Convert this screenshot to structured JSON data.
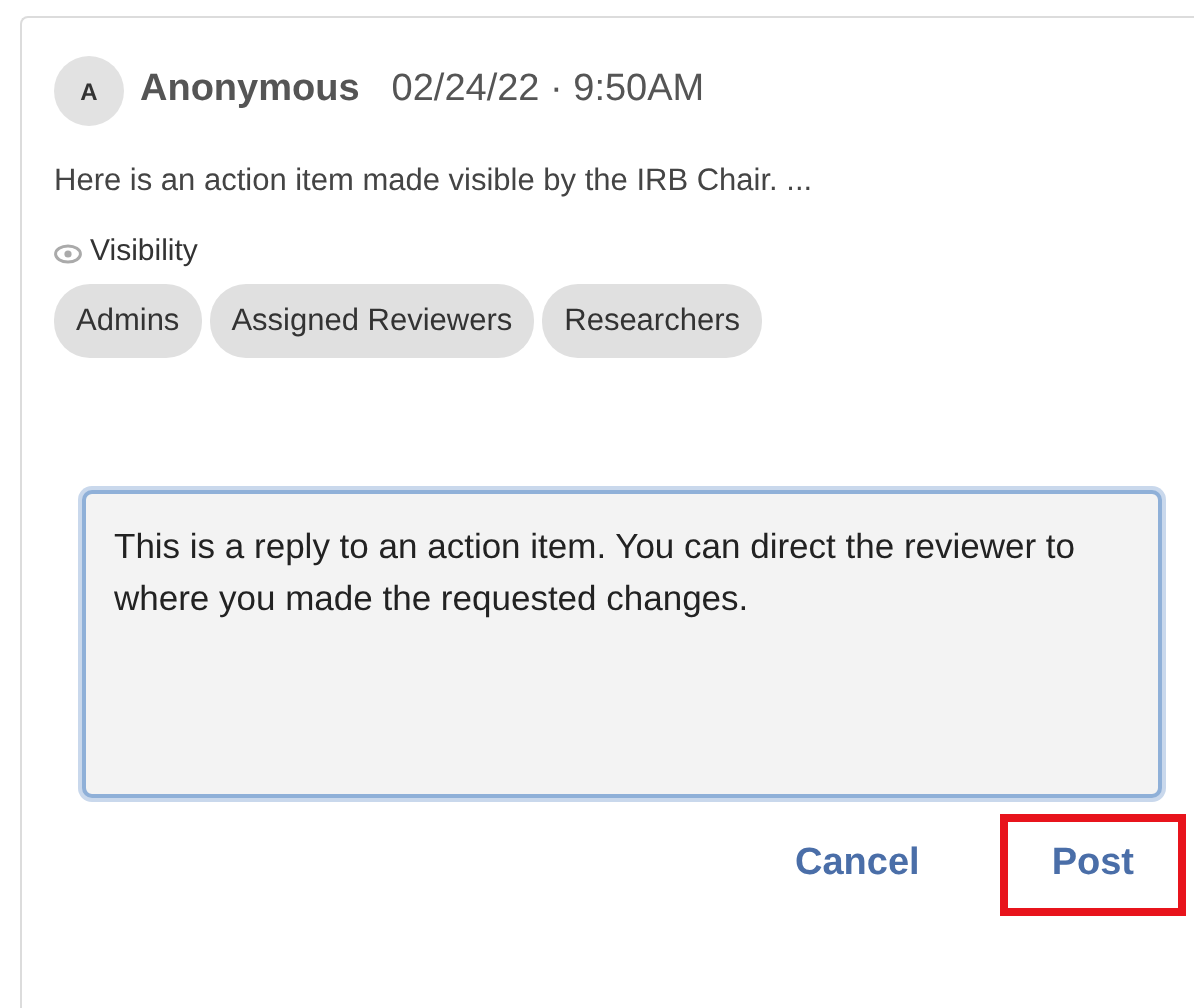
{
  "comment": {
    "avatar": "A",
    "author": "Anonymous",
    "timestamp": "02/24/22 · 9:50AM",
    "body": "Here is an action item made visible by the IRB Chair. ...",
    "visibility_label": "Visibility",
    "visibility_tags": [
      "Admins",
      "Assigned Reviewers",
      "Researchers"
    ]
  },
  "reply": {
    "value": "This is a reply to an action item. You can direct the reviewer to where you made the requested changes.",
    "focused": true
  },
  "buttons": [
    {
      "label": "Cancel",
      "highlighted": false
    },
    {
      "label": "Post",
      "highlighted": true
    }
  ]
}
